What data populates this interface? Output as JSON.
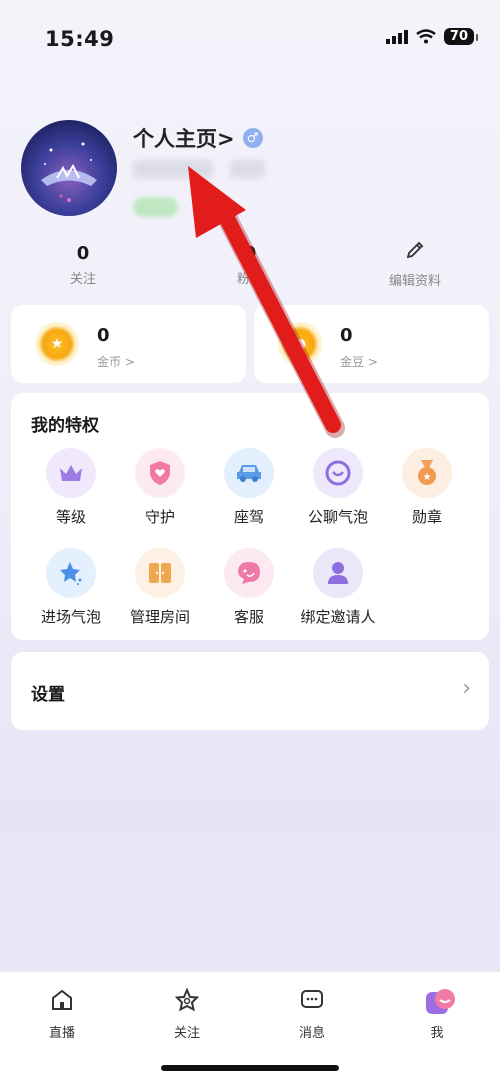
{
  "status": {
    "time": "15:49",
    "battery": "70"
  },
  "profile": {
    "title": "个人主页>",
    "gender_symbol": "♂"
  },
  "stats": [
    {
      "value": "0",
      "label": "关注"
    },
    {
      "value": "0",
      "label": "粉丝"
    }
  ],
  "edit_label": "编辑资料",
  "currency": [
    {
      "value": "0",
      "label": "金币 >"
    },
    {
      "value": "0",
      "label": "金豆 >"
    }
  ],
  "privileges": {
    "title": "我的特权",
    "items": [
      {
        "label": "等级",
        "icon": "crown-icon"
      },
      {
        "label": "守护",
        "icon": "heart-shield-icon"
      },
      {
        "label": "座驾",
        "icon": "car-icon"
      },
      {
        "label": "公聊气泡",
        "icon": "bubble-icon"
      },
      {
        "label": "勋章",
        "icon": "medal-icon"
      },
      {
        "label": "进场气泡",
        "icon": "star-icon"
      },
      {
        "label": "管理房间",
        "icon": "door-icon"
      },
      {
        "label": "客服",
        "icon": "customer-service-icon"
      },
      {
        "label": "绑定邀请人",
        "icon": "person-icon"
      }
    ]
  },
  "settings": {
    "label": "设置"
  },
  "nav": [
    {
      "label": "直播",
      "icon": "home-icon"
    },
    {
      "label": "关注",
      "icon": "star-outline-icon"
    },
    {
      "label": "消息",
      "icon": "message-icon"
    },
    {
      "label": "我",
      "icon": "me-avatar-icon"
    }
  ],
  "colors": {
    "accent": "#e5003a",
    "coin": "#f7a812",
    "arrow": "#e21b1b"
  }
}
